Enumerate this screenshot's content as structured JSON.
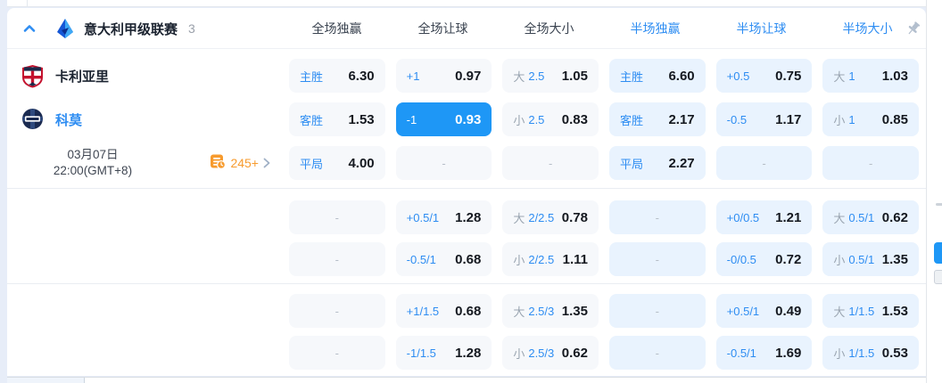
{
  "header": {
    "league": "意大利甲级联赛",
    "count": "3",
    "columns": [
      "全场独赢",
      "全场让球",
      "全场大小",
      "半场独赢",
      "半场让球",
      "半场大小"
    ]
  },
  "fixture": {
    "home": "卡利亚里",
    "away": "科莫",
    "date": "03月07日",
    "time": "22:00(GMT+8)",
    "markets_count": "245+"
  },
  "icons": {
    "collapse": "chevron-up-icon",
    "league": "serie-a-logo",
    "pin": "pin-icon",
    "markets": "markets-list-icon",
    "more": "chevron-right-icon"
  },
  "colors": {
    "accent_blue": "#2e8df2",
    "selected_blue": "#1e97f6",
    "orange": "#f79b2e",
    "fulltime_cell_bg": "#f6f8fb",
    "halftime_cell_bg": "#e9f3fe"
  },
  "odds": {
    "sections": [
      {
        "rows": [
          [
            {
              "label": "主胜",
              "value": "6.30"
            },
            {
              "label": "+1",
              "value": "0.97"
            },
            {
              "ou": "大",
              "line": "2.5",
              "value": "1.05"
            },
            {
              "label": "主胜",
              "value": "6.60"
            },
            {
              "label": "+0.5",
              "value": "0.75"
            },
            {
              "ou": "大",
              "line": "1",
              "value": "1.03"
            }
          ],
          [
            {
              "label": "客胜",
              "value": "1.53"
            },
            {
              "label": "-1",
              "value": "0.93",
              "selected": true
            },
            {
              "ou": "小",
              "line": "2.5",
              "value": "0.83"
            },
            {
              "label": "客胜",
              "value": "2.17"
            },
            {
              "label": "-0.5",
              "value": "1.17"
            },
            {
              "ou": "小",
              "line": "1",
              "value": "0.85"
            }
          ],
          [
            {
              "label": "平局",
              "value": "4.00"
            },
            {
              "dash": true
            },
            {
              "dash": true
            },
            {
              "label": "平局",
              "value": "2.27"
            },
            {
              "dash": true
            },
            {
              "dash": true
            }
          ]
        ]
      },
      {
        "rows": [
          [
            {
              "dash": true
            },
            {
              "label": "+0.5/1",
              "value": "1.28"
            },
            {
              "ou": "大",
              "line": "2/2.5",
              "value": "0.78"
            },
            {
              "dash": true
            },
            {
              "label": "+0/0.5",
              "value": "1.21"
            },
            {
              "ou": "大",
              "line": "0.5/1",
              "value": "0.62"
            }
          ],
          [
            {
              "dash": true
            },
            {
              "label": "-0.5/1",
              "value": "0.68"
            },
            {
              "ou": "小",
              "line": "2/2.5",
              "value": "1.11"
            },
            {
              "dash": true
            },
            {
              "label": "-0/0.5",
              "value": "0.72"
            },
            {
              "ou": "小",
              "line": "0.5/1",
              "value": "1.35"
            }
          ]
        ]
      },
      {
        "rows": [
          [
            {
              "dash": true
            },
            {
              "label": "+1/1.5",
              "value": "0.68"
            },
            {
              "ou": "大",
              "line": "2.5/3",
              "value": "1.35"
            },
            {
              "dash": true
            },
            {
              "label": "+0.5/1",
              "value": "0.49"
            },
            {
              "ou": "大",
              "line": "1/1.5",
              "value": "1.53"
            }
          ],
          [
            {
              "dash": true
            },
            {
              "label": "-1/1.5",
              "value": "1.28"
            },
            {
              "ou": "小",
              "line": "2.5/3",
              "value": "0.62"
            },
            {
              "dash": true
            },
            {
              "label": "-0.5/1",
              "value": "1.69"
            },
            {
              "ou": "小",
              "line": "1/1.5",
              "value": "0.53"
            }
          ]
        ]
      }
    ]
  }
}
